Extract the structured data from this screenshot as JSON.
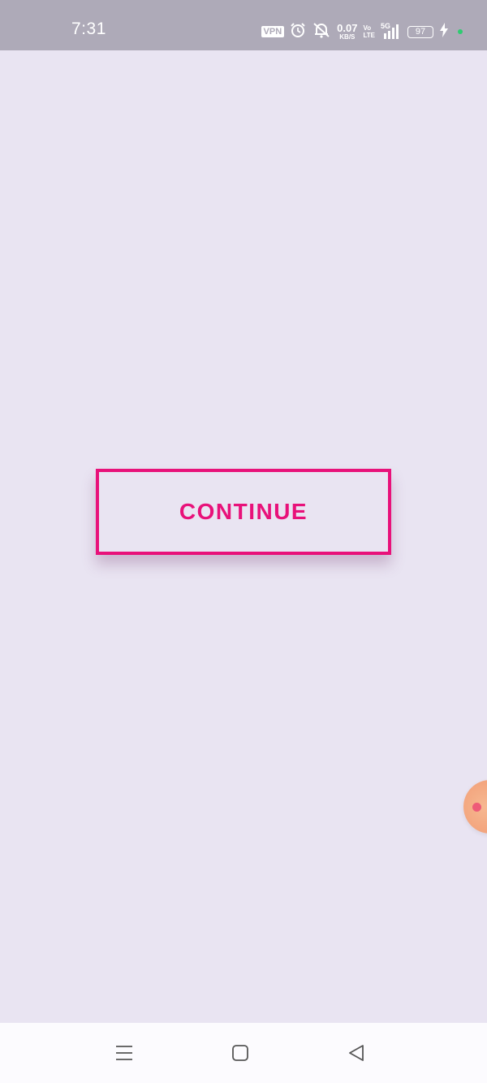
{
  "status_bar": {
    "time": "7:31",
    "vpn_label": "VPN",
    "net_speed_value": "0.07",
    "net_speed_unit": "KB/S",
    "volte_top": "Vo",
    "volte_bottom": "LTE",
    "network_type": "5G",
    "battery_level": "97",
    "icons": [
      "vpn-icon",
      "alarm-icon",
      "mute-bell-icon",
      "signal-icon",
      "battery-icon",
      "charging-icon",
      "privacy-dot"
    ],
    "colors": {
      "background": "#aeaab8",
      "privacy_dot": "#2ecc71"
    }
  },
  "main": {
    "continue_label": "CONTINUE",
    "colors": {
      "accent": "#e8117a",
      "background": "#e9e4f2"
    }
  },
  "floating_bubble": {
    "icon": "assistive-bubble-icon"
  },
  "nav_bar": {
    "icons": [
      "menu-icon",
      "home-icon",
      "back-icon"
    ]
  }
}
